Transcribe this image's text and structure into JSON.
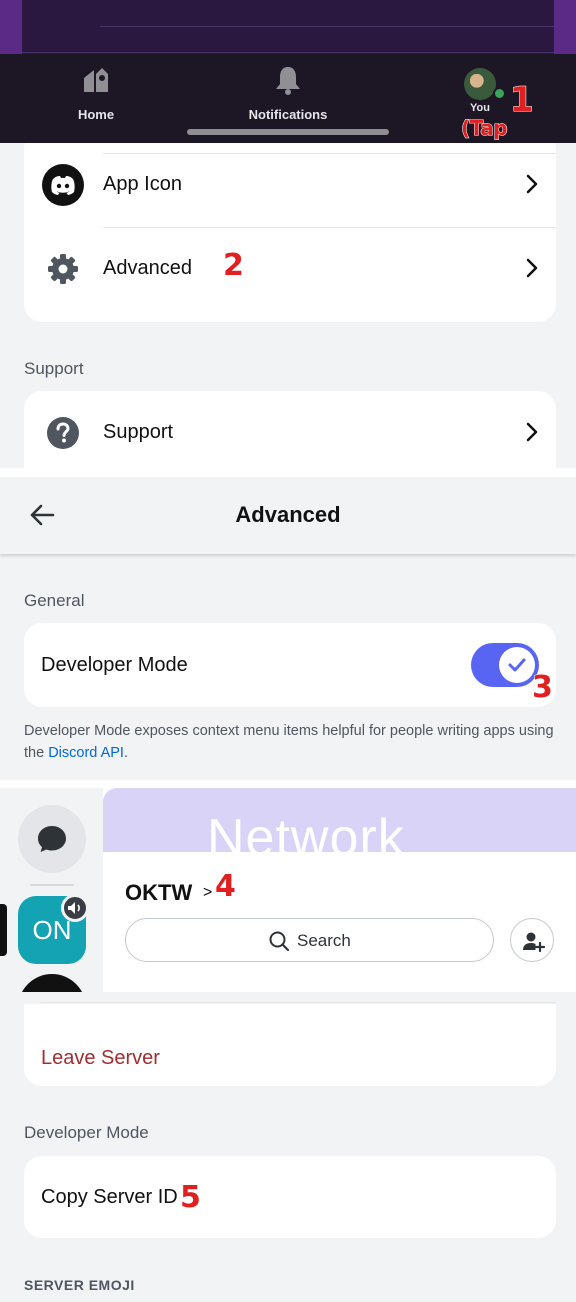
{
  "nav": {
    "items": [
      {
        "label": "Home",
        "icon": "home-icon"
      },
      {
        "label": "Notifications",
        "icon": "bell-icon"
      },
      {
        "label": "You",
        "icon": "avatar"
      }
    ]
  },
  "annotations": {
    "step1": "1",
    "step1_note": "(Tap Twice)",
    "step2": "2",
    "step3": "3",
    "step4": "4",
    "step5": "5"
  },
  "settings": {
    "rows": [
      {
        "label": "App Icon",
        "icon": "discord-logo-icon"
      },
      {
        "label": "Advanced",
        "icon": "gear-icon"
      }
    ],
    "support_section": "Support",
    "support_row": {
      "label": "Support",
      "icon": "question-circle-icon"
    }
  },
  "advanced": {
    "title": "Advanced",
    "section": "General",
    "developer_mode_label": "Developer Mode",
    "developer_mode_enabled": true,
    "help_text": "Developer Mode exposes context menu items helpful for people writing apps using the ",
    "help_link": "Discord API",
    "help_end": "."
  },
  "server": {
    "rail_icon_text": "ON",
    "banner_text": "Network",
    "name": "OKTW",
    "chevron": ">",
    "search_label": "Search"
  },
  "server_settings": {
    "leave_label": "Leave Server",
    "dev_section": "Developer Mode",
    "copy_id_label": "Copy Server ID",
    "emoji_section": "SERVER EMOJI"
  },
  "colors": {
    "accent": "#5865f2",
    "danger": "#a12d2f",
    "link": "#0068e0",
    "annotation": "#e02020",
    "online": "#3ba55d"
  }
}
